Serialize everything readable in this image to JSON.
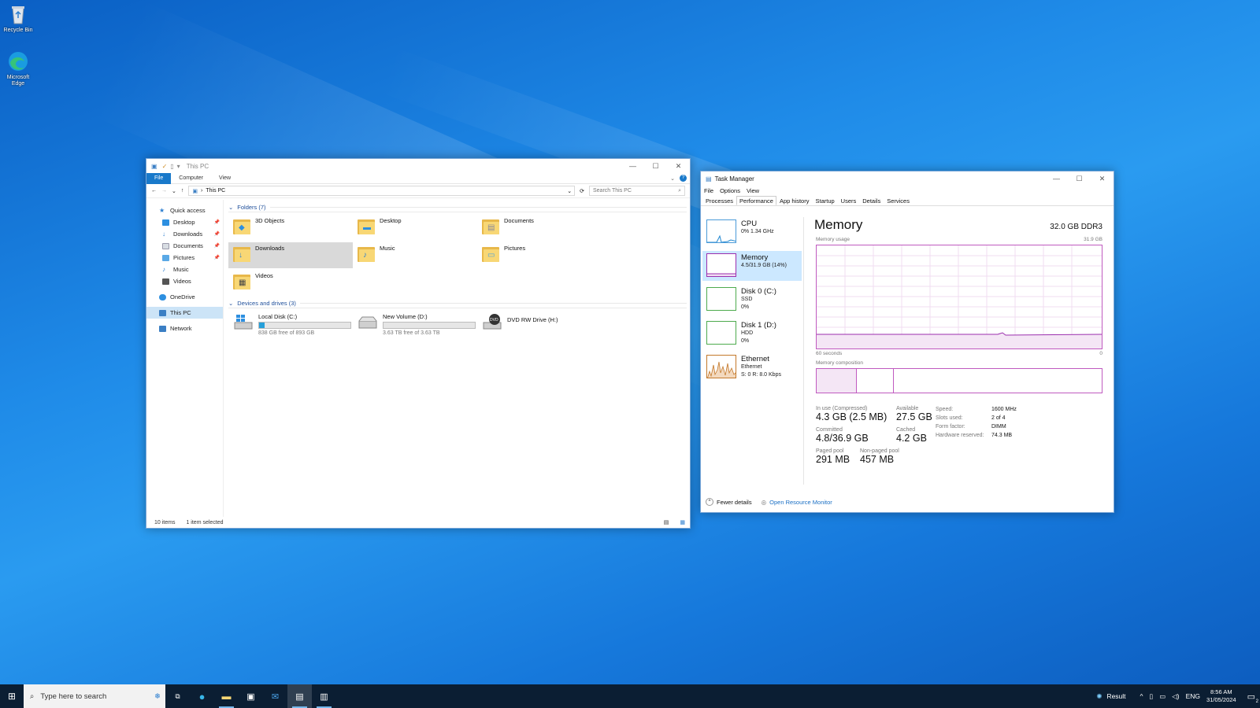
{
  "desktop": {
    "icons": [
      {
        "label": "Recycle Bin"
      },
      {
        "label": "Microsoft Edge"
      }
    ]
  },
  "explorer": {
    "title": "This PC",
    "ribbon_tabs": [
      "File",
      "Computer",
      "View"
    ],
    "address": "This PC",
    "search_placeholder": "Search This PC",
    "nav": {
      "quick_access": "Quick access",
      "items": [
        "Desktop",
        "Downloads",
        "Documents",
        "Pictures",
        "Music",
        "Videos"
      ],
      "onedrive": "OneDrive",
      "this_pc": "This PC",
      "network": "Network"
    },
    "folders_header": "Folders (7)",
    "folders": [
      "3D Objects",
      "Desktop",
      "Documents",
      "Downloads",
      "Music",
      "Pictures",
      "Videos"
    ],
    "devices_header": "Devices and drives (3)",
    "drives": [
      {
        "name": "Local Disk (C:)",
        "free": "838 GB free of 893 GB",
        "used_fraction": 0.06
      },
      {
        "name": "New Volume (D:)",
        "free": "3.63 TB free of 3.63 TB",
        "used_fraction": 0.0
      },
      {
        "name": "DVD RW Drive (H:)",
        "free": ""
      }
    ],
    "status_items": "10 items",
    "status_selected": "1 item selected"
  },
  "taskmanager": {
    "title": "Task Manager",
    "menu": [
      "File",
      "Options",
      "View"
    ],
    "tabs": [
      "Processes",
      "Performance",
      "App history",
      "Startup",
      "Users",
      "Details",
      "Services"
    ],
    "side": [
      {
        "name": "CPU",
        "l1": "0% 1.34 GHz",
        "l2": ""
      },
      {
        "name": "Memory",
        "l1": "4.5/31.9 GB (14%)",
        "l2": ""
      },
      {
        "name": "Disk 0 (C:)",
        "l1": "SSD",
        "l2": "0%"
      },
      {
        "name": "Disk 1 (D:)",
        "l1": "HDD",
        "l2": "0%"
      },
      {
        "name": "Ethernet",
        "l1": "Ethernet",
        "l2": "S: 0 R: 8.0 Kbps"
      }
    ],
    "heading": "Memory",
    "capacity": "32.0 GB DDR3",
    "usage_label": "Memory usage",
    "usage_max": "31.9 GB",
    "time_left": "60 seconds",
    "time_right": "0",
    "composition_label": "Memory composition",
    "stats": {
      "in_use_label": "In use (Compressed)",
      "in_use": "4.3 GB (2.5 MB)",
      "available_label": "Available",
      "available": "27.5 GB",
      "committed_label": "Committed",
      "committed": "4.8/36.9 GB",
      "cached_label": "Cached",
      "cached": "4.2 GB",
      "paged_label": "Paged pool",
      "paged": "291 MB",
      "nonpaged_label": "Non-paged pool",
      "nonpaged": "457 MB"
    },
    "hw": {
      "speed_k": "Speed:",
      "speed_v": "1600 MHz",
      "slots_k": "Slots used:",
      "slots_v": "2 of 4",
      "form_k": "Form factor:",
      "form_v": "DIMM",
      "hwres_k": "Hardware reserved:",
      "hwres_v": "74.3 MB"
    },
    "fewer_details": "Fewer details",
    "open_resmon": "Open Resource Monitor"
  },
  "taskbar": {
    "search_placeholder": "Type here to search",
    "weather": "Result",
    "lang": "ENG",
    "time": "8:56 AM",
    "date": "31/05/2024",
    "notification_count": "2"
  },
  "colors": {
    "accent": "#0078d7",
    "memory": "#c05ac0",
    "selection": "#cce8ff"
  }
}
